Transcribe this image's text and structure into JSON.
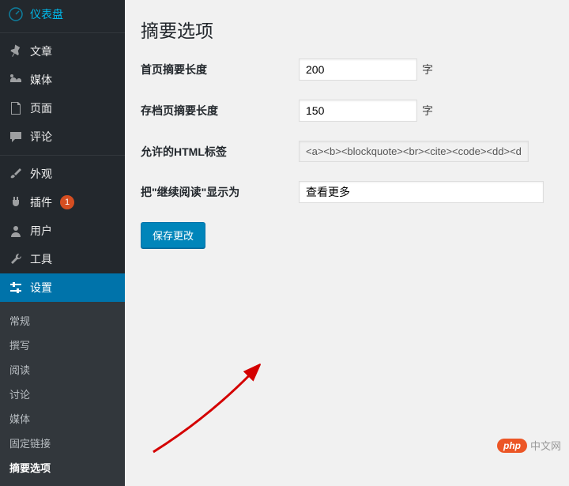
{
  "sidebar": {
    "items": [
      {
        "label": "仪表盘",
        "icon": "dashboard"
      },
      {
        "label": "文章",
        "icon": "pin"
      },
      {
        "label": "媒体",
        "icon": "media"
      },
      {
        "label": "页面",
        "icon": "page"
      },
      {
        "label": "评论",
        "icon": "comment"
      },
      {
        "label": "外观",
        "icon": "brush"
      },
      {
        "label": "插件",
        "icon": "plugin",
        "badge": "1"
      },
      {
        "label": "用户",
        "icon": "user"
      },
      {
        "label": "工具",
        "icon": "tool"
      },
      {
        "label": "设置",
        "icon": "settings",
        "active": true
      }
    ],
    "submenu": [
      {
        "label": "常规"
      },
      {
        "label": "撰写"
      },
      {
        "label": "阅读"
      },
      {
        "label": "讨论"
      },
      {
        "label": "媒体"
      },
      {
        "label": "固定链接"
      },
      {
        "label": "摘要选项",
        "active": true
      }
    ]
  },
  "main": {
    "title": "摘要选项",
    "rows": [
      {
        "label": "首页摘要长度",
        "value": "200",
        "suffix": "字",
        "type": "number"
      },
      {
        "label": "存档页摘要长度",
        "value": "150",
        "suffix": "字",
        "type": "number"
      },
      {
        "label": "允许的HTML标签",
        "value": "<a><b><blockquote><br><cite><code><dd><d",
        "type": "tags"
      },
      {
        "label": "把\"继续阅读\"显示为",
        "value": "查看更多",
        "type": "text"
      }
    ],
    "save": "保存更改"
  },
  "logo": {
    "badge": "php",
    "text": "中文网"
  }
}
